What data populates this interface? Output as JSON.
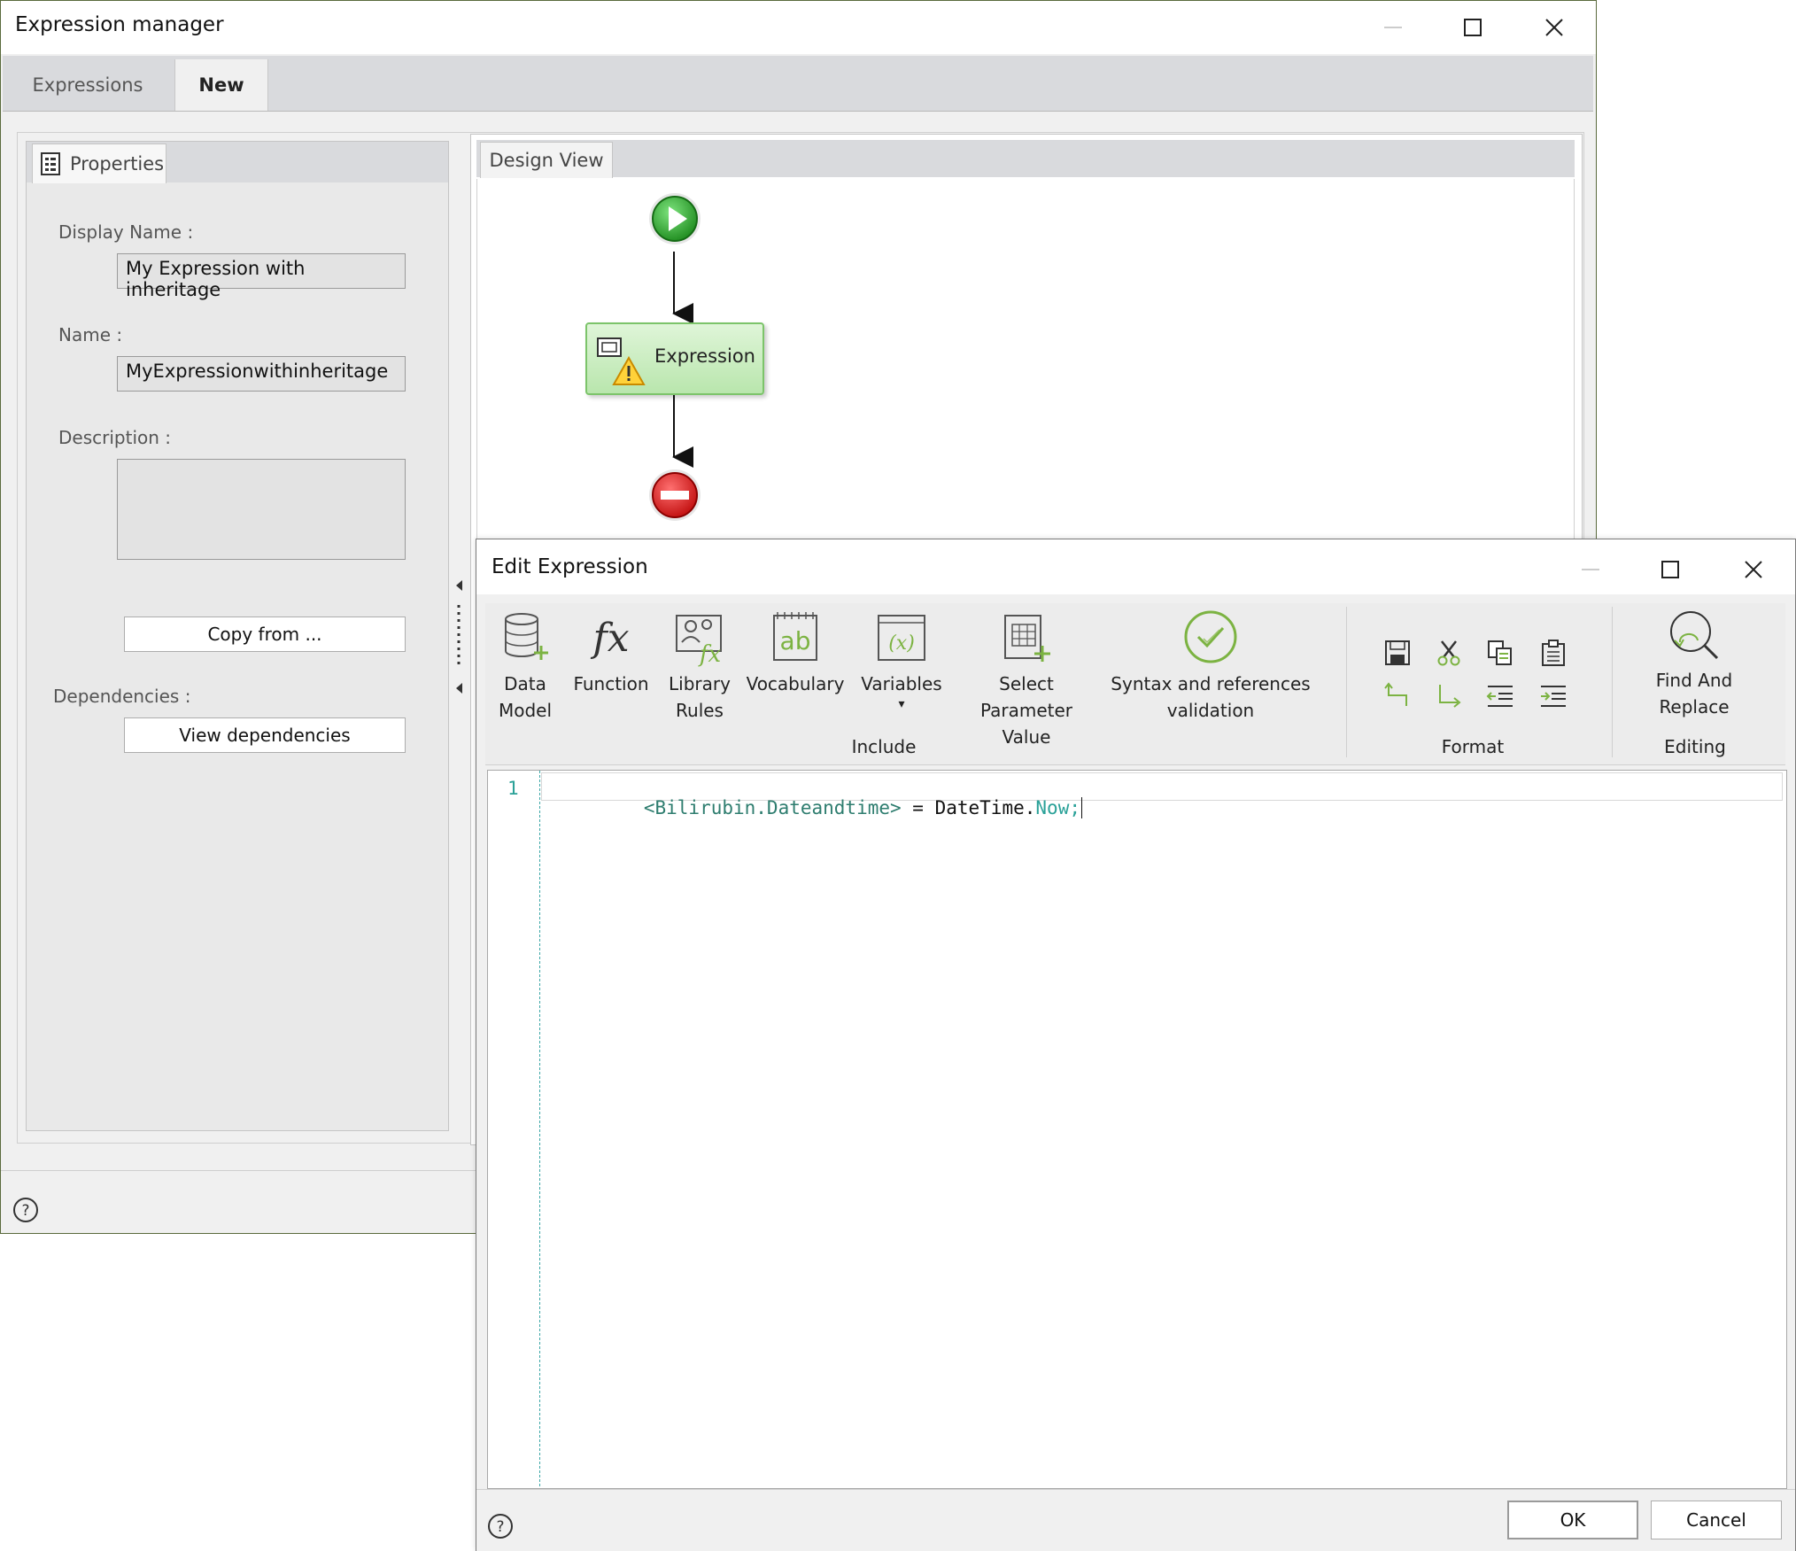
{
  "manager": {
    "title": "Expression manager",
    "tabs": [
      {
        "label": "Expressions"
      },
      {
        "label": "New"
      }
    ],
    "properties": {
      "tab_label": "Properties",
      "display_name_label": "Display Name :",
      "display_name_value": "My Expression with inheritage",
      "name_label": "Name :",
      "name_value": "MyExpressionwithinheritage",
      "description_label": "Description :",
      "description_value": "",
      "copy_from_label": "Copy from ...",
      "dependencies_label": "Dependencies :",
      "view_dependencies_label": "View dependencies"
    },
    "design_view": {
      "tab_label": "Design View",
      "node_label": "Expression"
    }
  },
  "editor": {
    "title": "Edit Expression",
    "toolbar": {
      "data_model": [
        "Data",
        "Model"
      ],
      "function": "Function",
      "library_rules": [
        "Library",
        "Rules"
      ],
      "vocabulary": "Vocabulary",
      "variables": "Variables",
      "variables_arrow": "▾",
      "select_parameter": [
        "Select Parameter",
        "Value"
      ],
      "syntax": [
        "Syntax and references",
        "validation"
      ],
      "include_group": "Include",
      "format_group": "Format",
      "find_replace": [
        "Find And",
        "Replace"
      ],
      "editing_group": "Editing"
    },
    "code": {
      "line_number": "1",
      "tokens": [
        "<Bilirubin.Dateandtime>",
        " = ",
        "DateTime",
        ".",
        "Now",
        ";"
      ]
    },
    "ok_label": "OK",
    "cancel_label": "Cancel"
  },
  "colors": {
    "accent_green": "#7cb342",
    "start_green": "#2ea02e",
    "stop_red": "#d81f1f",
    "code_keyword": "#2aa198"
  }
}
